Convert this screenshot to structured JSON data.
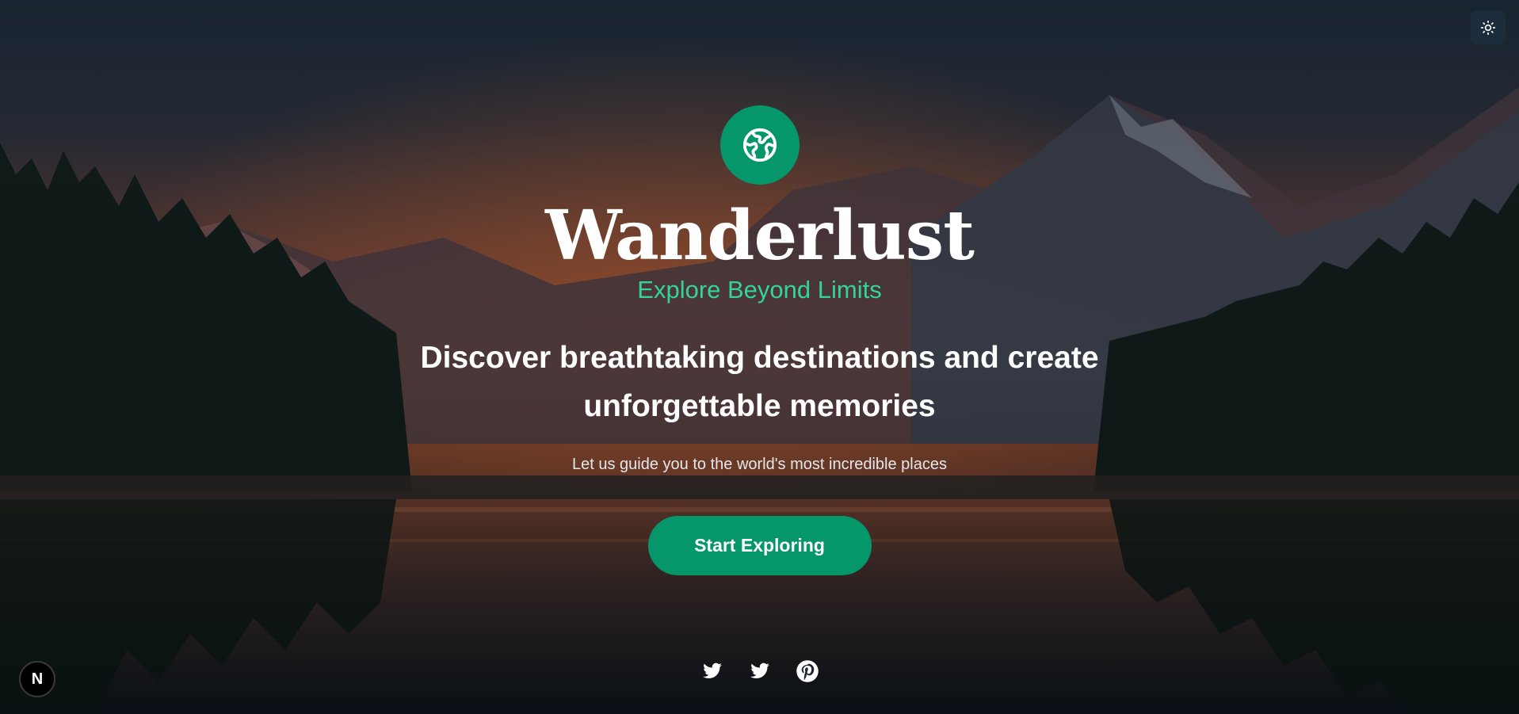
{
  "background": {
    "description_icon": "mountain-lake-sunset-image"
  },
  "theme_toggle": {
    "icon": "sun-icon"
  },
  "hero": {
    "logo_icon": "globe-icon",
    "brand": "Wanderlust",
    "tagline": "Explore Beyond Limits",
    "headline": "Discover breathtaking destinations and create unforgettable memories",
    "subtext": "Let us guide you to the world's most incredible places",
    "cta_label": "Start Exploring"
  },
  "socials": [
    {
      "icon": "twitter-icon"
    },
    {
      "icon": "twitter-icon"
    },
    {
      "icon": "pinterest-icon"
    }
  ],
  "dev_badge": {
    "label": "N"
  },
  "colors": {
    "accent": "#05966a",
    "tagline": "#34d399",
    "text": "#ffffff"
  }
}
